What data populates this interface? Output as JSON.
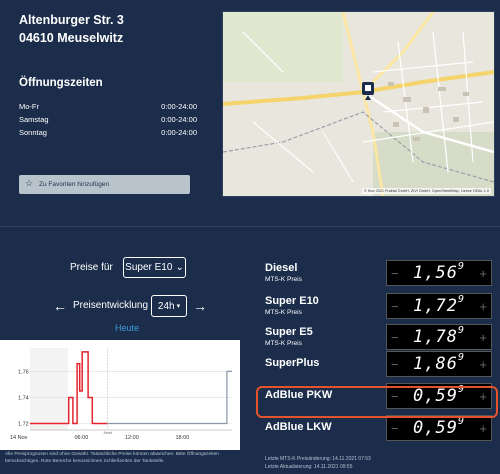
{
  "station": {
    "street": "Altenburger Str. 3",
    "city": "04610 Meuselwitz"
  },
  "hours": {
    "title": "Öffnungszeiten",
    "rows": [
      {
        "day": "Mo-Fr",
        "time": "0:00-24:00"
      },
      {
        "day": "Samstag",
        "time": "0:00-24:00"
      },
      {
        "day": "Sonntag",
        "time": "0:00-24:00"
      }
    ]
  },
  "favorite_button": "Zu Favoriten hinzufügen",
  "map": {
    "streets": [
      "Zeitzer Straße",
      "Lucka Straße",
      "Bahnhofstraße",
      "Rudolf-Breitscheid-Straße"
    ],
    "copyright": "© Nov 2021 Fraktal GmbH, ZIVI GmbH, OpenStreetMap, Lizenz ODbL 1.0"
  },
  "controls": {
    "prices_for_label": "Preise für",
    "fuel_selected": "Super E10",
    "development_label": "Preisentwicklung",
    "range_selected": "24h",
    "today_label": "Heute"
  },
  "chart_data": {
    "type": "line",
    "x_ticks": [
      "14 Nov",
      "06:00",
      "12:00",
      "18:00"
    ],
    "now_label": "Jetzt",
    "y_ticks": [
      "1.72",
      "1.74",
      "1.76"
    ],
    "ylim": [
      1.715,
      1.778
    ],
    "series": [
      {
        "points": [
          [
            0,
            1.72
          ],
          [
            4.6,
            1.72
          ],
          [
            4.6,
            1.74
          ],
          [
            5.1,
            1.74
          ],
          [
            5.1,
            1.72
          ],
          [
            5.6,
            1.72
          ],
          [
            5.6,
            1.766
          ],
          [
            5.9,
            1.766
          ],
          [
            5.9,
            1.745
          ],
          [
            6.2,
            1.745
          ],
          [
            6.2,
            1.775
          ],
          [
            6.9,
            1.775
          ],
          [
            6.9,
            1.74
          ],
          [
            7.4,
            1.74
          ],
          [
            7.4,
            1.72
          ],
          [
            9.2,
            1.72
          ]
        ]
      },
      {
        "points": [
          [
            9.2,
            1.72
          ],
          [
            23.4,
            1.72
          ],
          [
            23.4,
            1.76
          ],
          [
            24,
            1.76
          ]
        ]
      }
    ],
    "colors": {
      "past": "#e4252d",
      "forecast": "#8a96a8",
      "closed": "#56344a"
    },
    "closed_ranges": [
      [
        0,
        4.5
      ]
    ]
  },
  "footnote": "Alle Preisprognosen sind ohne Gewähr. Tatsächliche Preise können abweichen. Bitte Öffnungszeiten berücksichtigen. Rote Bereiche kennzeichnen Schließzeiten der Tankstelle.",
  "prices": [
    {
      "name": "Diesel",
      "sub": "MTS-K Preis",
      "main": "1,56",
      "sup": "9"
    },
    {
      "name": "Super E10",
      "sub": "MTS-K Preis",
      "main": "1,72",
      "sup": "9"
    },
    {
      "name": "Super E5",
      "sub": "MTS-K Preis",
      "main": "1,78",
      "sup": "9"
    },
    {
      "name": "SuperPlus",
      "sub": "",
      "main": "1,86",
      "sup": "9"
    },
    {
      "name": "AdBlue PKW",
      "sub": "",
      "main": "0,59",
      "sup": "9"
    },
    {
      "name": "AdBlue LKW",
      "sub": "",
      "main": "0,59",
      "sup": "9"
    }
  ],
  "meta": {
    "mtsk_change": "Letzte MTS-K Preisänderung: 14.11.2021 07:53",
    "last_update": "Letzte Aktualisierung: 14.11.2021 09:55"
  },
  "accent": "#e4542c"
}
